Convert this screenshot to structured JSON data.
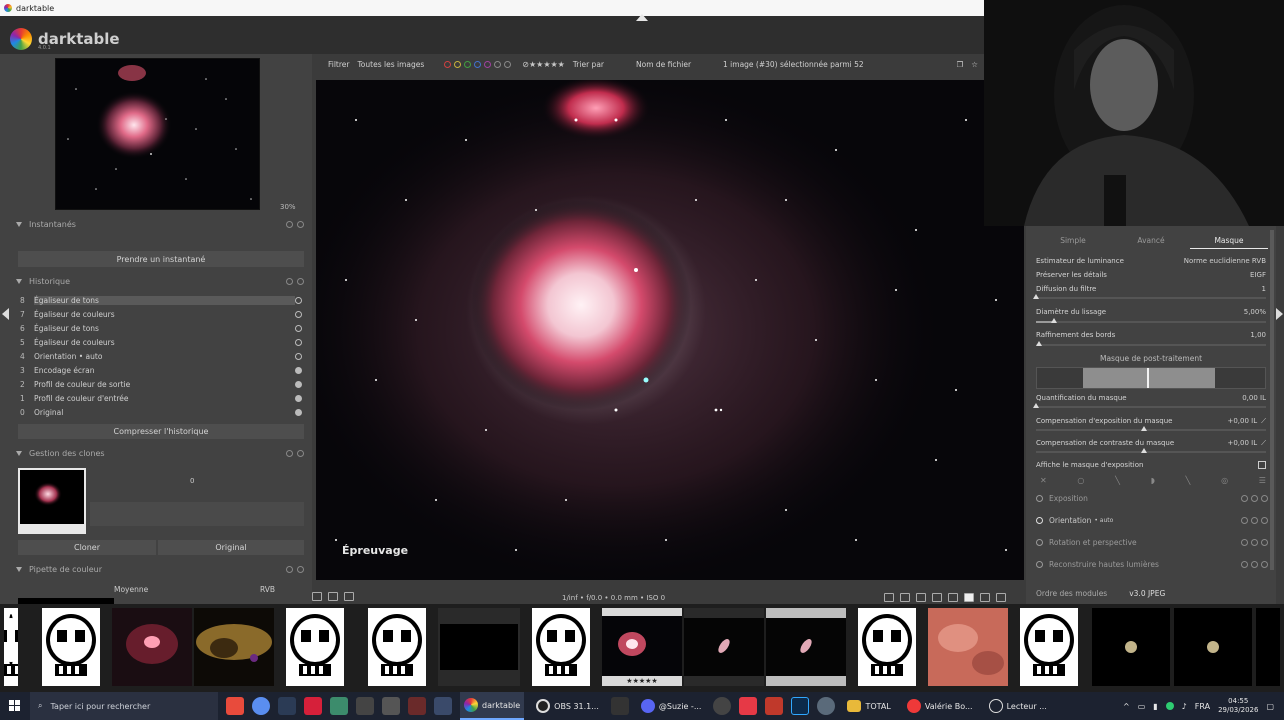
{
  "window": {
    "title": "darktable"
  },
  "app": {
    "name": "darktable",
    "version": "4.0.1"
  },
  "left": {
    "zoom": "30%",
    "snapshots": {
      "title": "Instantanés",
      "button": "Prendre un instantané"
    },
    "history": {
      "title": "Historique",
      "items": [
        {
          "num": "8",
          "label": "Égaliseur de tons",
          "selected": true,
          "on": false
        },
        {
          "num": "7",
          "label": "Égaliseur de couleurs",
          "selected": false,
          "on": false
        },
        {
          "num": "6",
          "label": "Égaliseur de tons",
          "selected": false,
          "on": false
        },
        {
          "num": "5",
          "label": "Égaliseur de couleurs",
          "selected": false,
          "on": false
        },
        {
          "num": "4",
          "label": "Orientation • auto",
          "selected": false,
          "on": false
        },
        {
          "num": "3",
          "label": "Encodage écran",
          "selected": false,
          "on": true
        },
        {
          "num": "2",
          "label": "Profil de couleur de sortie",
          "selected": false,
          "on": true
        },
        {
          "num": "1",
          "label": "Profil de couleur d'entrée",
          "selected": false,
          "on": true
        },
        {
          "num": "0",
          "label": "Original",
          "selected": false,
          "on": true
        }
      ],
      "compress": "Compresser l'historique"
    },
    "clones": {
      "title": "Gestion des clones",
      "count": "0",
      "clone": "Cloner",
      "original": "Original"
    },
    "colorpicker": {
      "title": "Pipette de couleur",
      "mode": "Moyenne",
      "space": "RVB"
    }
  },
  "filterbar": {
    "filter_label": "Filtrer",
    "filter_value": "Toutes les images",
    "sort_label": "Trier par",
    "sort_value": "Nom de fichier",
    "selection": "1 image (#30) sélectionnée parmi 52"
  },
  "center": {
    "proof": "Épreuvage",
    "exif": "1/inf • f/0.0 • 0.0 mm • ISO 0"
  },
  "right": {
    "tabs": [
      "Simple",
      "Avancé",
      "Masque"
    ],
    "params": [
      {
        "label": "Estimateur de luminance",
        "value": "Norme euclidienne RVB"
      },
      {
        "label": "Préserver les détails",
        "value": "EIGF"
      },
      {
        "label": "Diffusion du filtre",
        "value": "1"
      },
      {
        "label": "Diamètre du lissage",
        "value": "5,00%"
      },
      {
        "label": "Raffinement des bords",
        "value": "1,00"
      }
    ],
    "mask_section": "Masque de post-traitement",
    "mask_params": [
      {
        "label": "Quantification du masque",
        "value": "0,00 IL"
      },
      {
        "label": "Compensation d'exposition du masque",
        "value": "+0,00 IL"
      },
      {
        "label": "Compensation de contraste du masque",
        "value": "+0,00 IL"
      }
    ],
    "show_mask": "Affiche le masque d'exposition",
    "modules": [
      "Exposition",
      "Orientation",
      "Rotation et perspective",
      "Reconstruire hautes lumières"
    ],
    "orientation_suffix": "• auto",
    "order_label": "Ordre des modules",
    "order_value": "v3.0 JPEG"
  },
  "filmstrip": {
    "selected_rating": "★★★★★"
  },
  "taskbar": {
    "search_placeholder": "Taper ici pour rechercher",
    "items": [
      "darktable",
      "OBS 31.1...",
      "@Suzie -...",
      "TOTAL",
      "Valérie Bo...",
      "Lecteur ..."
    ],
    "lang": "FRA",
    "time": "04:55",
    "date": "29/03/2026"
  },
  "colors": {
    "accent_blue": "#6fa8ff",
    "panel": "#424242",
    "image_bg": "#07060a"
  }
}
